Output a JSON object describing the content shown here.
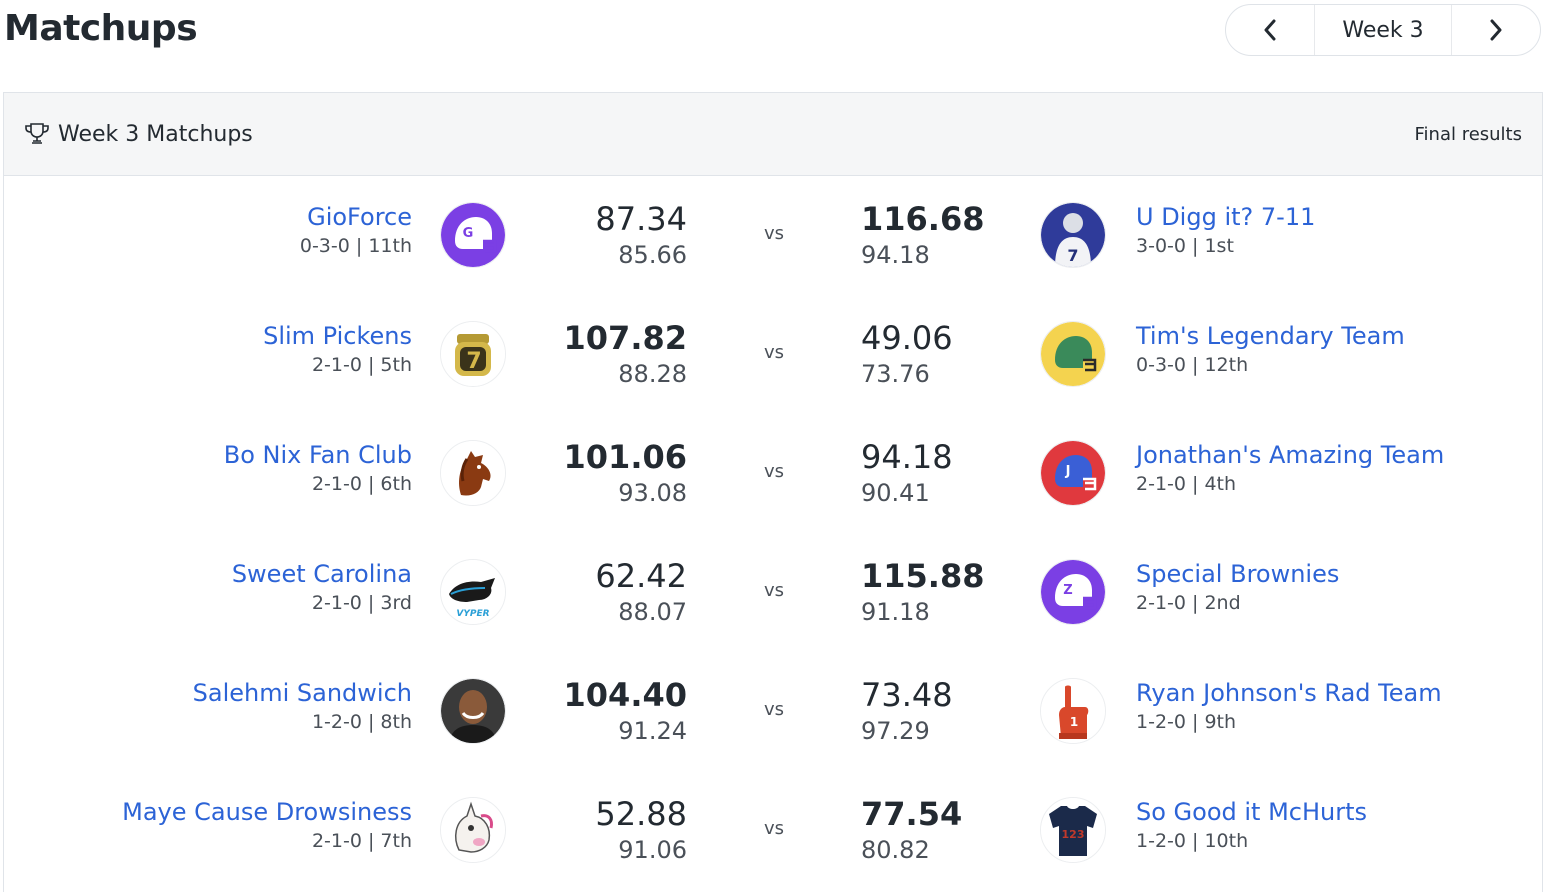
{
  "page": {
    "title": "Matchups"
  },
  "week_nav": {
    "label": "Week 3"
  },
  "panel": {
    "title": "Week 3 Matchups",
    "status": "Final results"
  },
  "vs_label": "vs",
  "matchups": [
    {
      "left": {
        "name": "GioForce",
        "record": "0-3-0 | 11th",
        "score": "87.34",
        "proj": "85.66"
      },
      "right": {
        "name": "U Digg it? 7-11",
        "record": "3-0-0 | 1st",
        "score": "116.68",
        "proj": "94.18"
      }
    },
    {
      "left": {
        "name": "Slim Pickens",
        "record": "2-1-0 | 5th",
        "score": "107.82",
        "proj": "88.28"
      },
      "right": {
        "name": "Tim's Legendary Team",
        "record": "0-3-0 | 12th",
        "score": "49.06",
        "proj": "73.76"
      }
    },
    {
      "left": {
        "name": "Bo Nix Fan Club",
        "record": "2-1-0 | 6th",
        "score": "101.06",
        "proj": "93.08"
      },
      "right": {
        "name": "Jonathan's Amazing Team",
        "record": "2-1-0 | 4th",
        "score": "94.18",
        "proj": "90.41"
      }
    },
    {
      "left": {
        "name": "Sweet Carolina",
        "record": "2-1-0 | 3rd",
        "score": "62.42",
        "proj": "88.07"
      },
      "right": {
        "name": "Special Brownies",
        "record": "2-1-0 | 2nd",
        "score": "115.88",
        "proj": "91.18"
      }
    },
    {
      "left": {
        "name": "Salehmi Sandwich",
        "record": "1-2-0 | 8th",
        "score": "104.40",
        "proj": "91.24"
      },
      "right": {
        "name": "Ryan Johnson's Rad Team",
        "record": "1-2-0 | 9th",
        "score": "73.48",
        "proj": "97.29"
      }
    },
    {
      "left": {
        "name": "Maye Cause Drowsiness",
        "record": "2-1-0 | 7th",
        "score": "52.88",
        "proj": "91.06"
      },
      "right": {
        "name": "So Good it McHurts",
        "record": "1-2-0 | 10th",
        "score": "77.54",
        "proj": "80.82"
      }
    }
  ],
  "colors": {
    "link": "#2c63d6",
    "text": "#232a31",
    "muted": "#4a5058",
    "header_bg": "#f5f6f7"
  }
}
